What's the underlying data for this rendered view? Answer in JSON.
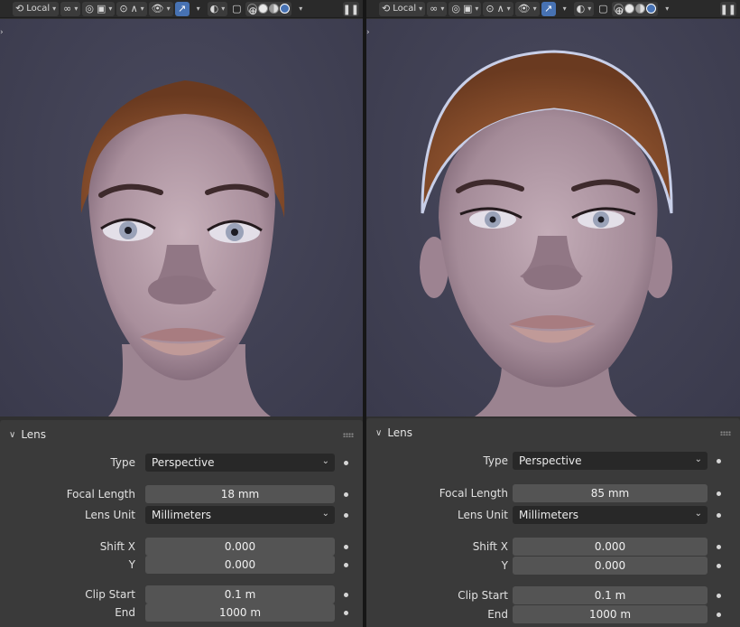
{
  "header": {
    "pivot_label": "Local",
    "icons": [
      "transform-orientation-icon",
      "snap-icon",
      "proportional-icon",
      "object-icon",
      "overlay-icon",
      "gizmo-icon",
      "xray-icon",
      "shading-icon",
      "pause-icon"
    ]
  },
  "panes": [
    {
      "id": "left",
      "viewport": {
        "focal_mm": 18
      },
      "lens": {
        "title": "Lens",
        "type_label": "Type",
        "type_value": "Perspective",
        "focal_label": "Focal Length",
        "focal_value": "18 mm",
        "unit_label": "Lens Unit",
        "unit_value": "Millimeters",
        "shiftx_label": "Shift X",
        "shiftx_value": "0.000",
        "shifty_label": "Y",
        "shifty_value": "0.000",
        "clipstart_label": "Clip Start",
        "clipstart_value": "0.1 m",
        "clipend_label": "End",
        "clipend_value": "1000 m"
      }
    },
    {
      "id": "right",
      "viewport": {
        "focal_mm": 85
      },
      "lens": {
        "title": "Lens",
        "type_label": "Type",
        "type_value": "Perspective",
        "focal_label": "Focal Length",
        "focal_value": "85 mm",
        "unit_label": "Lens Unit",
        "unit_value": "Millimeters",
        "shiftx_label": "Shift X",
        "shiftx_value": "0.000",
        "shifty_label": "Y",
        "shifty_value": "0.000",
        "clipstart_label": "Clip Start",
        "clipstart_value": "0.1 m",
        "clipend_label": "End",
        "clipend_value": "1000 m"
      }
    }
  ],
  "colors": {
    "viewport_bg": "#414154",
    "skin": "#b9a3ad",
    "hair": "#9a5a32",
    "active_blue": "#4772b3"
  }
}
